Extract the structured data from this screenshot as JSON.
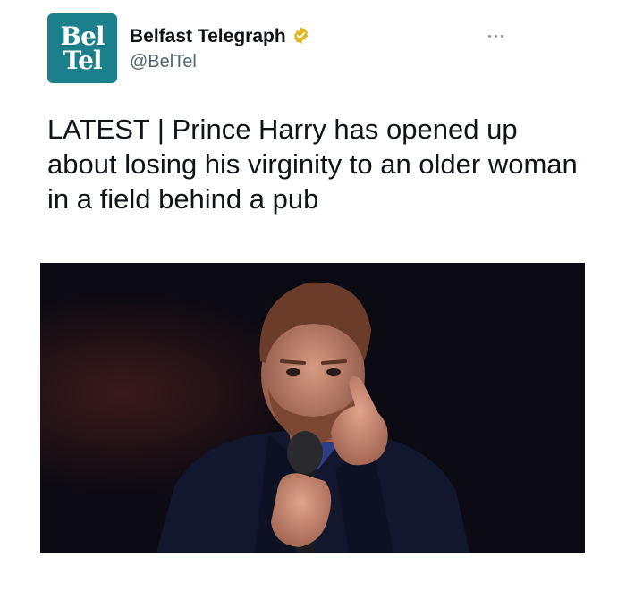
{
  "tweet": {
    "avatar_lines": [
      "Bel",
      "Tel"
    ],
    "author_name": "Belfast Telegraph",
    "verified_color": "#e2b719",
    "handle": "@BelTel",
    "text": "LATEST | Prince Harry has opened up about losing his virginity to an older woman in a field behind a pub",
    "media_icon": "photo-of-man-speaking-into-microphone-pointing"
  },
  "colors": {
    "avatar_bg": "#1b7f8c",
    "text": "#0f1419",
    "secondary": "#536471",
    "media_bg": "#0c0a12"
  }
}
